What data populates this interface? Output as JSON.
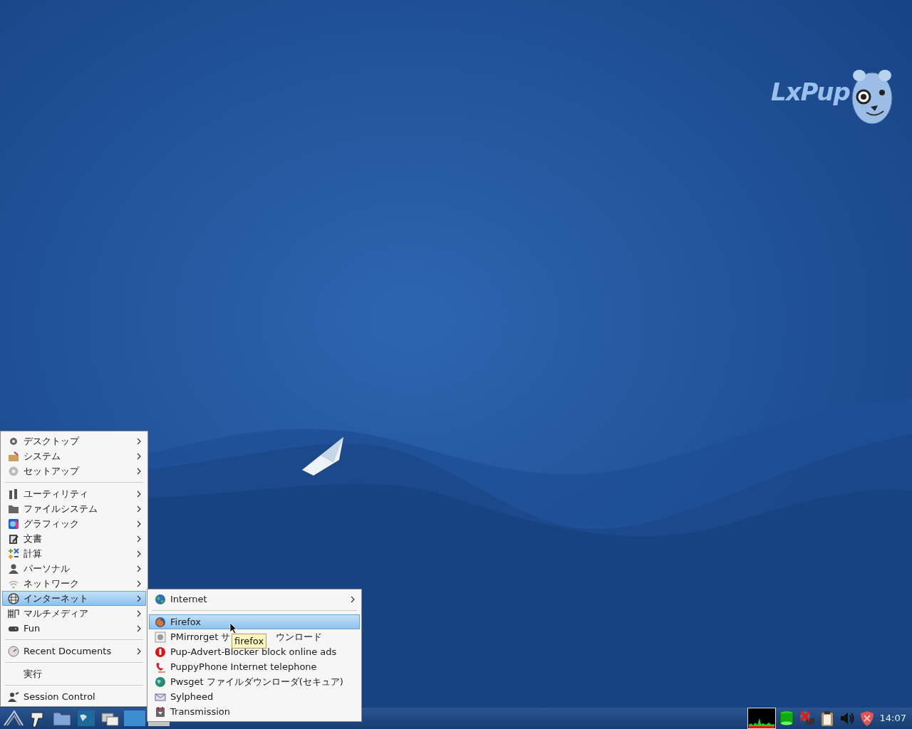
{
  "desktop": {
    "logo_text": "LxPup"
  },
  "main_menu": {
    "items": [
      {
        "kind": "item",
        "label": "デスクトップ",
        "submenu": true,
        "selected": false
      },
      {
        "kind": "item",
        "label": "システム",
        "submenu": true,
        "selected": false
      },
      {
        "kind": "item",
        "label": "セットアップ",
        "submenu": true,
        "selected": false
      },
      {
        "kind": "separator"
      },
      {
        "kind": "item",
        "label": "ユーティリティ",
        "submenu": true,
        "selected": false
      },
      {
        "kind": "item",
        "label": "ファイルシステム",
        "submenu": true,
        "selected": false
      },
      {
        "kind": "item",
        "label": "グラフィック",
        "submenu": true,
        "selected": false
      },
      {
        "kind": "item",
        "label": "文書",
        "submenu": true,
        "selected": false
      },
      {
        "kind": "item",
        "label": "計算",
        "submenu": true,
        "selected": false
      },
      {
        "kind": "item",
        "label": "パーソナル",
        "submenu": true,
        "selected": false
      },
      {
        "kind": "item",
        "label": "ネットワーク",
        "submenu": true,
        "selected": false
      },
      {
        "kind": "item",
        "label": "インターネット",
        "submenu": true,
        "selected": true
      },
      {
        "kind": "item",
        "label": "マルチメディア",
        "submenu": true,
        "selected": false
      },
      {
        "kind": "item",
        "label": "Fun",
        "submenu": true,
        "selected": false
      },
      {
        "kind": "separator"
      },
      {
        "kind": "item",
        "label": "Recent Documents",
        "submenu": true,
        "selected": false
      },
      {
        "kind": "separator"
      },
      {
        "kind": "item",
        "label": "実行",
        "submenu": false,
        "selected": false
      },
      {
        "kind": "separator"
      },
      {
        "kind": "item",
        "label": "Session Control",
        "submenu": false,
        "selected": false
      }
    ]
  },
  "submenu": {
    "items": [
      {
        "kind": "item",
        "label": "Internet",
        "submenu": true,
        "selected": false
      },
      {
        "kind": "separator"
      },
      {
        "kind": "item",
        "label": "Firefox",
        "submenu": false,
        "selected": true
      },
      {
        "kind": "item",
        "label": "PMirrorget サ",
        "label_tail": "ウンロード",
        "submenu": false,
        "selected": false
      },
      {
        "kind": "item",
        "label": "Pup-Advert-Blocker block online ads",
        "submenu": false,
        "selected": false
      },
      {
        "kind": "item",
        "label": "PuppyPhone Internet telephone",
        "submenu": false,
        "selected": false
      },
      {
        "kind": "item",
        "label": "Pwsget ファイルダウンローダ(セキュア)",
        "submenu": false,
        "selected": false
      },
      {
        "kind": "item",
        "label": "Sylpheed",
        "submenu": false,
        "selected": false
      },
      {
        "kind": "item",
        "label": "Transmission",
        "submenu": false,
        "selected": false
      }
    ]
  },
  "tooltip": {
    "text": "firefox"
  },
  "taskbar": {
    "pager": [
      {
        "selected": true
      },
      {
        "selected": false
      }
    ],
    "clock": "14:07"
  }
}
